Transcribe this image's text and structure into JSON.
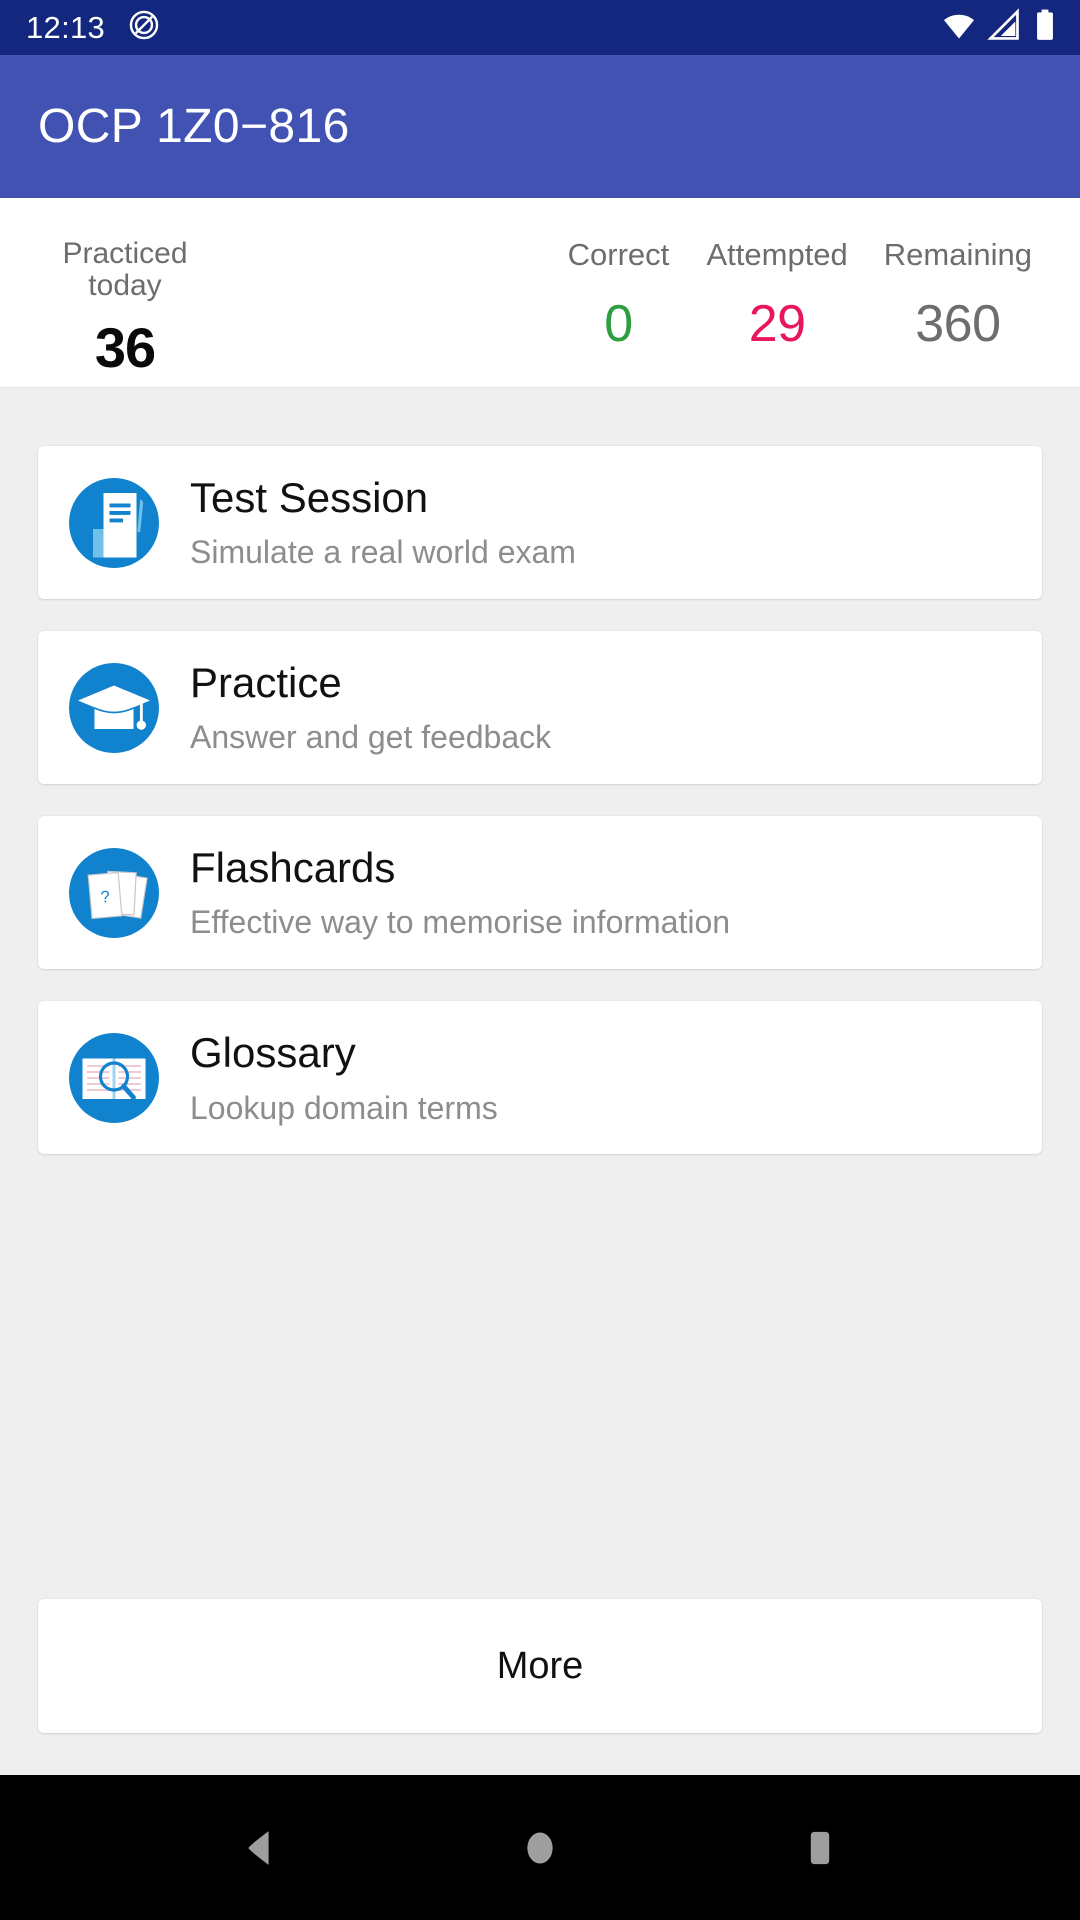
{
  "status_bar": {
    "time": "12:13",
    "icons": [
      "do-not-disturb-icon",
      "wifi-icon",
      "cellular-signal-icon",
      "battery-icon"
    ]
  },
  "app_bar": {
    "title": "OCP 1Z0−816"
  },
  "stats": {
    "practiced": {
      "label_line1": "Practiced",
      "label_line2": "today",
      "value": "36"
    },
    "metrics": [
      {
        "label": "Correct",
        "value": "0",
        "color": "#2e9e3e"
      },
      {
        "label": "Attempted",
        "value": "29",
        "color": "#e8165c"
      },
      {
        "label": "Remaining",
        "value": "360",
        "color": "#6d6d6d"
      }
    ]
  },
  "cards": [
    {
      "title": "Test Session",
      "subtitle": "Simulate a real world exam",
      "icon": "document-pen-icon"
    },
    {
      "title": "Practice",
      "subtitle": "Answer and get feedback",
      "icon": "graduation-cap-icon"
    },
    {
      "title": "Flashcards",
      "subtitle": "Effective way to memorise information",
      "icon": "flashcards-icon"
    },
    {
      "title": "Glossary",
      "subtitle": "Lookup domain terms",
      "icon": "book-search-icon"
    }
  ],
  "more_button": {
    "label": "More"
  },
  "nav_bar": {
    "back": "back-triangle-icon",
    "home": "home-circle-icon",
    "recents": "recents-square-icon"
  },
  "colors": {
    "status_bar": "#12277d",
    "app_bar": "#4152b3",
    "page_bg": "#efefef",
    "card_bg": "#ffffff",
    "icon_blue": "#1183ce",
    "correct_green": "#2e9e3e",
    "attempted_pink": "#e8165c",
    "remaining_grey": "#6d6d6d"
  }
}
